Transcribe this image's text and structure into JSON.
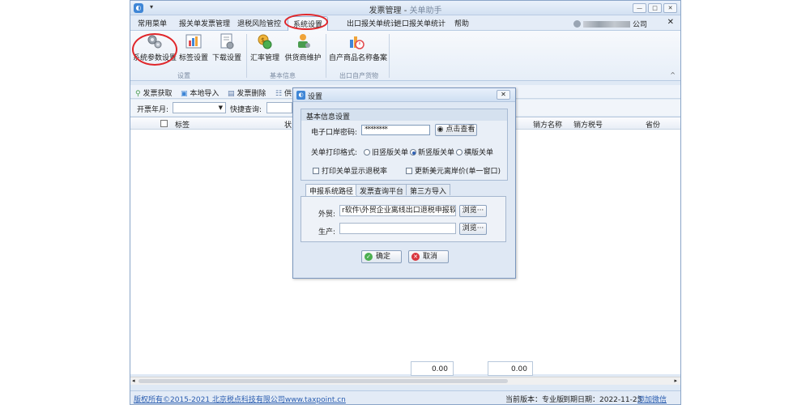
{
  "window": {
    "title": "发票管理",
    "subtitle": "关单助手",
    "qa_arrow": "▾",
    "min": "—",
    "max": "□",
    "close": "✕"
  },
  "menu": {
    "tabs": [
      "常用菜单",
      "报关单发票管理",
      "退税风险管控",
      "系统设置",
      "出口报关单统计",
      "进口报关单统计",
      "帮助"
    ],
    "active_tab": "系统设置",
    "account_suffix": "公司",
    "close": "✕"
  },
  "ribbon": {
    "buttons": [
      {
        "label": "系统参数设置",
        "icon": "gears-icon"
      },
      {
        "label": "标签设置",
        "icon": "tag-chart-icon"
      },
      {
        "label": "下载设置",
        "icon": "download-settings-icon"
      },
      {
        "label": "汇率管理",
        "icon": "exchange-rate-icon"
      },
      {
        "label": "供货商维护",
        "icon": "supplier-icon"
      },
      {
        "label": "自产商品名称备案",
        "icon": "product-record-icon"
      }
    ],
    "groups": [
      "设置",
      "基本信息",
      "出口自产货物"
    ],
    "collapse": "^"
  },
  "toolbar": {
    "items": [
      "发票获取",
      "本地导入",
      "发票删除",
      "供"
    ]
  },
  "filter": {
    "invoice_month_label": "开票年月:",
    "quick_query_label": "快捷查询:",
    "month_value": ""
  },
  "grid": {
    "columns_left": [
      "标签",
      "状"
    ],
    "columns_right": [
      "销方名称",
      "销方税号",
      "省份"
    ]
  },
  "totals": [
    "0.00",
    "0.00"
  ],
  "status": {
    "copyright": "版权所有©2015-2021 北京税点科技有限公司www.taxpoint.cn",
    "version": "当前版本：专业版",
    "expire": "到期日期：2022-11-25",
    "wechat": "添加微信"
  },
  "dialog": {
    "title": "设置",
    "close": "✕",
    "section": "基本信息设置",
    "password_label": "电子口岸密码:",
    "password_value": "********",
    "view_button": "点击查看",
    "print_format_label": "关单打印格式:",
    "print_formats": [
      "旧竖版关单",
      "新竖版关单",
      "横版关单"
    ],
    "print_format_selected": "新竖版关单",
    "checkbox_print_rate": "打印关单显示退税率",
    "checkbox_update_usd": "更新美元离岸价(单一窗口)",
    "tabs": [
      "申报系统路径",
      "发票查询平台",
      "第三方导入"
    ],
    "active_tab": "申报系统路径",
    "foreign_trade_label": "外贸:",
    "foreign_trade_path": "r软件\\外贸企业离线出口退税申报软件",
    "production_label": "生产:",
    "production_path": "",
    "browse": "浏览···",
    "ok": "确定",
    "cancel": "取消"
  }
}
